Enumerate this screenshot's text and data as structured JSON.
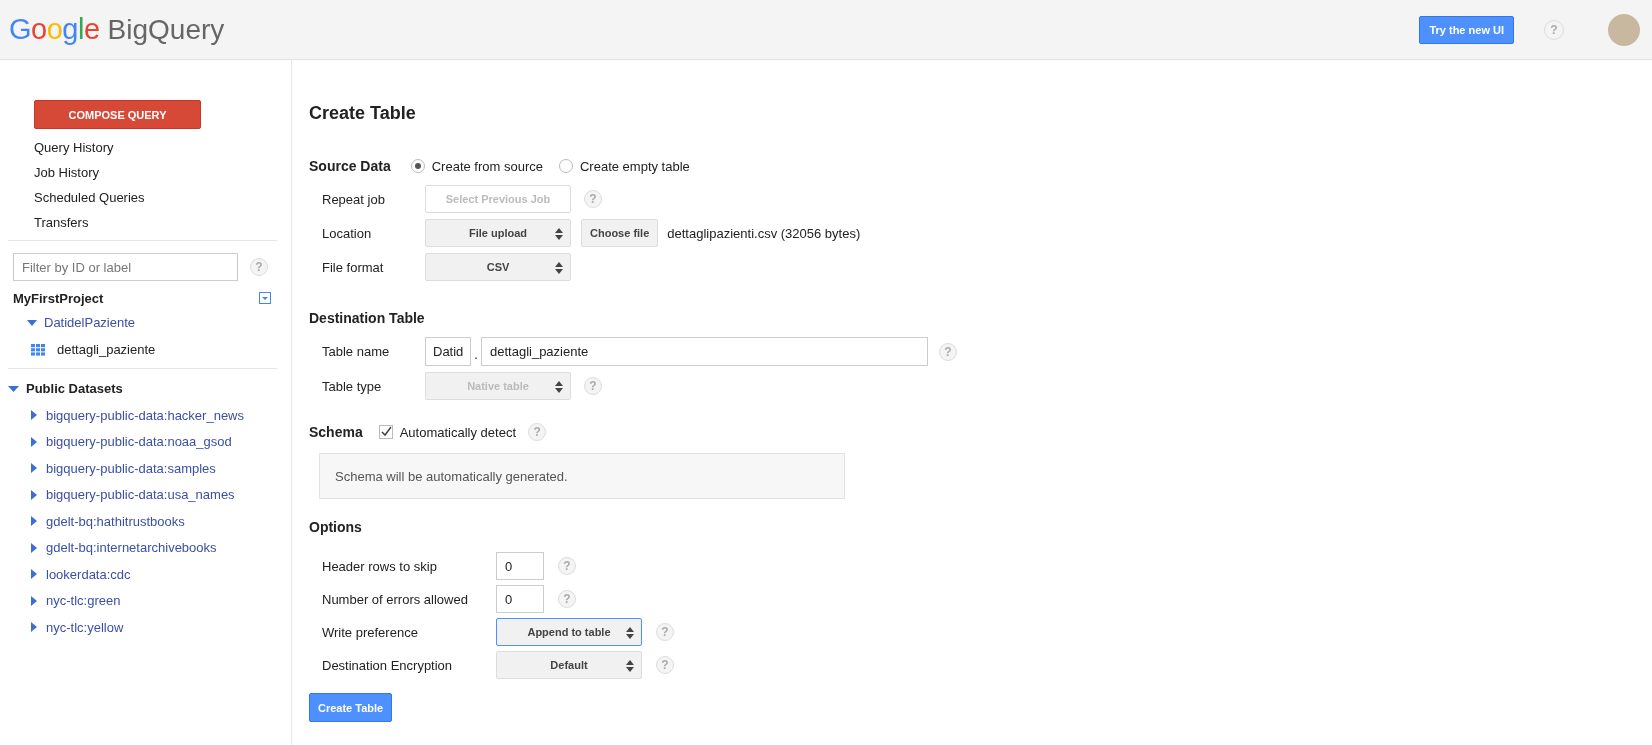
{
  "header": {
    "logo_letters": [
      {
        "char": "G",
        "color": "#4285f4"
      },
      {
        "char": "o",
        "color": "#ea4335"
      },
      {
        "char": "o",
        "color": "#fbbc05"
      },
      {
        "char": "g",
        "color": "#4285f4"
      },
      {
        "char": "l",
        "color": "#34a853"
      },
      {
        "char": "e",
        "color": "#ea4335"
      }
    ],
    "product": "BigQuery",
    "try_button": "Try the new UI",
    "help": "?"
  },
  "sidebar": {
    "compose_button": "COMPOSE QUERY",
    "links": [
      "Query History",
      "Job History",
      "Scheduled Queries",
      "Transfers"
    ],
    "filter": {
      "placeholder": "Filter by ID or label"
    },
    "filter_help": "?",
    "project": {
      "name": "MyFirstProject",
      "datasets": [
        {
          "name": "DatidelPaziente",
          "expanded": true,
          "children": [
            {
              "name": "dettagli_paziente"
            }
          ]
        }
      ]
    },
    "public": {
      "name": "Public Datasets",
      "expanded": true,
      "children": [
        {
          "name": "bigquery-public-data:hacker_news",
          "expanded": false
        },
        {
          "name": "bigquery-public-data:noaa_gsod",
          "expanded": false
        },
        {
          "name": "bigquery-public-data:samples",
          "expanded": false
        },
        {
          "name": "bigquery-public-data:usa_names",
          "expanded": false
        },
        {
          "name": "gdelt-bq:hathitrustbooks",
          "expanded": false
        },
        {
          "name": "gdelt-bq:internetarchivebooks",
          "expanded": false
        },
        {
          "name": "lookerdata:cdc",
          "expanded": false
        },
        {
          "name": "nyc-tlc:green",
          "expanded": false
        },
        {
          "name": "nyc-tlc:yellow",
          "expanded": false
        }
      ]
    }
  },
  "main": {
    "title": "Create Table",
    "source": {
      "heading": "Source Data",
      "radios": [
        {
          "label": "Create from source",
          "selected": true
        },
        {
          "label": "Create empty table",
          "selected": false
        }
      ],
      "rows": [
        {
          "label": "Repeat job",
          "kind": "button",
          "value": "Select Previous Job",
          "disabled": true,
          "help": "?"
        },
        {
          "label": "Location",
          "kind": "select",
          "value": "File upload",
          "disabled": false,
          "file_button": "Choose file",
          "file_name": "dettaglipazienti.csv (32056 bytes)"
        },
        {
          "label": "File format",
          "kind": "select",
          "value": "CSV",
          "disabled": false
        }
      ]
    },
    "destination": {
      "heading": "Destination Table",
      "table_name_label": "Table name",
      "dataset": "Datid",
      "separator": ".",
      "table_name": "dettagli_paziente",
      "table_name_help": "?",
      "table_type_label": "Table type",
      "table_type": "Native table",
      "table_type_disabled": true,
      "table_type_help": "?"
    },
    "schema": {
      "heading": "Schema",
      "auto_label": "Automatically detect",
      "checked": true,
      "help": "?",
      "note": "Schema will be automatically generated."
    },
    "options": {
      "heading": "Options",
      "rows": [
        {
          "label": "Header rows to skip",
          "kind": "input",
          "value": "0",
          "focused": false,
          "help": "?"
        },
        {
          "label": "Number of errors allowed",
          "kind": "input",
          "value": "0",
          "focused": false,
          "help": "?"
        },
        {
          "label": "Write preference",
          "kind": "select",
          "value": "Append to table",
          "focused": true,
          "help": "?"
        },
        {
          "label": "Destination Encryption",
          "kind": "select",
          "value": "Default",
          "focused": false,
          "help": "?"
        }
      ]
    },
    "submit": "Create Table"
  }
}
